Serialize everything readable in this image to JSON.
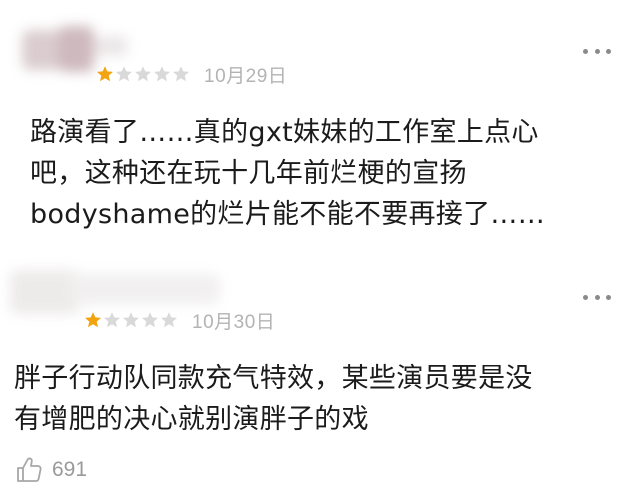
{
  "reviews": [
    {
      "rating": 1,
      "max_rating": 5,
      "date": "10月29日",
      "comment": "路演看了……真的gxt妹妹的工作室上点心\n吧，这种还在玩十几年前烂梗的宣扬\nbodyshame的烂片能不能不要再接了……",
      "more_icon": "more-dots-icon"
    },
    {
      "rating": 1,
      "max_rating": 5,
      "date": "10月30日",
      "comment": "胖子行动队同款充气特效，某些演员要是没\n有增肥的决心就别演胖子的戏",
      "more_icon": "more-dots-icon",
      "like_icon": "thumbs-up-icon",
      "like_count": "691"
    }
  ],
  "colors": {
    "star_filled": "#f2a310",
    "star_empty": "#d9d9d9",
    "date": "#b3b3b3",
    "text": "#1b1b1b"
  }
}
